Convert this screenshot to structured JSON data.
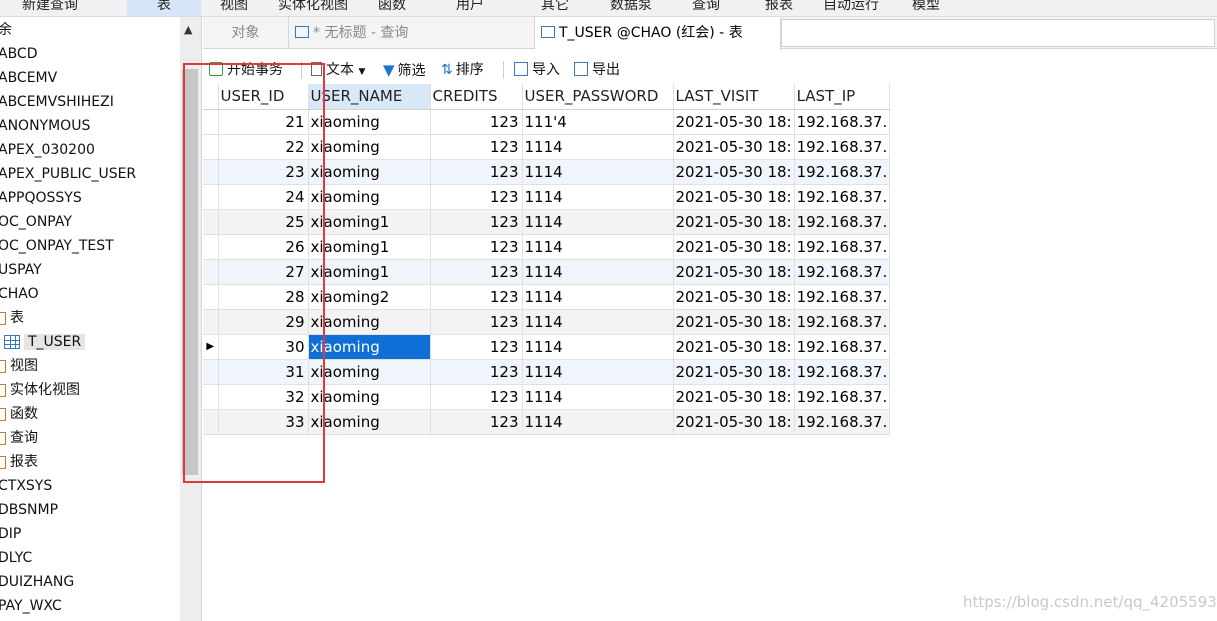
{
  "menubar": {
    "items": [
      "新建查询",
      "表",
      "视图",
      "实体化视图",
      "函数",
      "用户",
      "其它",
      "数据泵",
      "查询",
      "报表",
      "自动运行",
      "模型"
    ],
    "active_index": 1
  },
  "navtree": {
    "items": [
      {
        "label": "余",
        "icon": ""
      },
      {
        "label": "ABCD",
        "icon": ""
      },
      {
        "label": "ABCEMV",
        "icon": ""
      },
      {
        "label": "ABCEMVSHIHEZI",
        "icon": ""
      },
      {
        "label": "ANONYMOUS",
        "icon": ""
      },
      {
        "label": "APEX_030200",
        "icon": ""
      },
      {
        "label": "APEX_PUBLIC_USER",
        "icon": ""
      },
      {
        "label": "APPQOSSYS",
        "icon": ""
      },
      {
        "label": "OC_ONPAY",
        "icon": ""
      },
      {
        "label": "OC_ONPAY_TEST",
        "icon": ""
      },
      {
        "label": "USPAY",
        "icon": ""
      },
      {
        "label": "CHAO",
        "icon": ""
      },
      {
        "label": "表",
        "icon": "table-folder-icon"
      },
      {
        "label": "T_USER",
        "icon": "table-icon"
      },
      {
        "label": "视图",
        "icon": "view-icon"
      },
      {
        "label": "实体化视图",
        "icon": "materialized-view-icon"
      },
      {
        "label": "函数",
        "icon": "function-icon"
      },
      {
        "label": "查询",
        "icon": "query-icon"
      },
      {
        "label": "报表",
        "icon": "report-icon"
      },
      {
        "label": "CTXSYS",
        "icon": ""
      },
      {
        "label": "DBSNMP",
        "icon": ""
      },
      {
        "label": "DIP",
        "icon": ""
      },
      {
        "label": "DLYC",
        "icon": ""
      },
      {
        "label": "DUIZHANG",
        "icon": ""
      },
      {
        "label": "PAY_WXC",
        "icon": ""
      }
    ],
    "selected_label": "T_USER"
  },
  "tabs": [
    {
      "label": "对象",
      "icon": ""
    },
    {
      "label": "* 无标题 - 查询",
      "icon": "query-tab-icon"
    },
    {
      "label": "T_USER @CHAO (红会) - 表",
      "icon": "table-tab-icon"
    }
  ],
  "toolbar": {
    "begin_transaction": "开始事务",
    "text": "文本",
    "filter": "筛选",
    "sort": "排序",
    "import": "导入",
    "export": "导出"
  },
  "grid": {
    "columns": [
      "USER_ID",
      "USER_NAME",
      "CREDITS",
      "USER_PASSWORD",
      "LAST_VISIT",
      "LAST_IP"
    ],
    "highlighted_column": "USER_NAME",
    "rows": [
      [
        "21",
        "xiaoming",
        "123",
        "111'4",
        "2021-05-30 18:",
        "192.168.37."
      ],
      [
        "22",
        "xiaoming",
        "123",
        "1114",
        "2021-05-30 18:",
        "192.168.37."
      ],
      [
        "23",
        "xiaoming",
        "123",
        "1114",
        "2021-05-30 18:",
        "192.168.37."
      ],
      [
        "24",
        "xiaoming",
        "123",
        "1114",
        "2021-05-30 18:",
        "192.168.37."
      ],
      [
        "25",
        "xiaoming1",
        "123",
        "1114",
        "2021-05-30 18:",
        "192.168.37."
      ],
      [
        "26",
        "xiaoming1",
        "123",
        "1114",
        "2021-05-30 18:",
        "192.168.37."
      ],
      [
        "27",
        "xiaoming1",
        "123",
        "1114",
        "2021-05-30 18:",
        "192.168.37."
      ],
      [
        "28",
        "xiaoming2",
        "123",
        "1114",
        "2021-05-30 18:",
        "192.168.37."
      ],
      [
        "29",
        "xiaoming",
        "123",
        "1114",
        "2021-05-30 18:",
        "192.168.37."
      ],
      [
        "30",
        "xiaoming",
        "123",
        "1114",
        "2021-05-30 18:",
        "192.168.37."
      ],
      [
        "31",
        "xiaoming",
        "123",
        "1114",
        "2021-05-30 18:",
        "192.168.37."
      ],
      [
        "32",
        "xiaoming",
        "123",
        "1114",
        "2021-05-30 18:",
        "192.168.37."
      ],
      [
        "33",
        "xiaoming",
        "123",
        "1114",
        "2021-05-30 18:",
        "192.168.37."
      ]
    ],
    "current_row_index": 9,
    "selected_cell": "USER_NAME",
    "current_row_marker": "▶"
  },
  "colors": {
    "accent_selection": "#0f6fd6",
    "annotation_red": "#e0393d",
    "header_highlight": "#d9e8f7"
  },
  "watermark": "https://blog.csdn.net/qq_42055933"
}
